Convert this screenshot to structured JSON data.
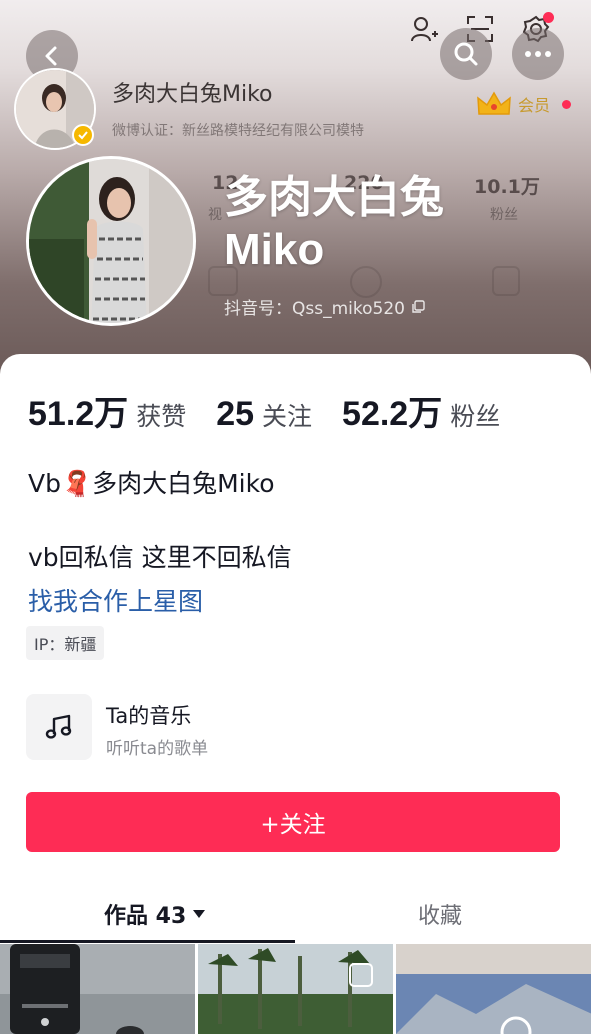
{
  "header": {
    "back_icon": "chevron-left-icon",
    "top_icons": [
      "add-friend-icon",
      "scan-icon",
      "settings-icon"
    ],
    "search_icon": "search-icon",
    "more_icon": "more-icon",
    "ghost": {
      "name": "多肉大白兔Miko",
      "weibo_verify": "微博认证：新丝路模特经纪有限公司模特",
      "videos_num": "12",
      "videos_label": "视",
      "follow_num": "220",
      "fans_num": "10.1万",
      "fans_label": "粉丝"
    },
    "vip_label": "会员",
    "big_name": "多肉大白兔Miko",
    "douyin_id": "抖音号：Qss_miko520"
  },
  "stats": {
    "likes_num": "51.2万",
    "likes_label": "获赞",
    "following_num": "25",
    "following_label": "关注",
    "fans_num": "52.2万",
    "fans_label": "粉丝"
  },
  "bio": {
    "line1": "Vb🧣多肉大白兔Miko",
    "line2": "vb回私信  这里不回私信",
    "link": "找我合作上星图",
    "ip": "IP：新疆"
  },
  "music": {
    "icon": "music-note-icon",
    "title": "Ta的音乐",
    "subtitle": "听听ta的歌单"
  },
  "follow_button": "+关注",
  "tabs": {
    "works": "作品 43",
    "favorites": "收藏"
  },
  "colors": {
    "accent": "#fe2c55",
    "link": "#2a5ea8",
    "vip_gold": "#c79a2e"
  }
}
